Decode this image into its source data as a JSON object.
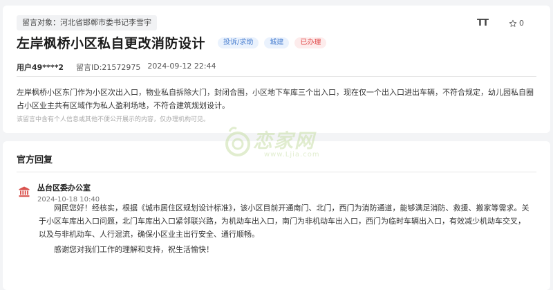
{
  "message": {
    "target": "留言对象：河北省邯郸市委书记李雪宇",
    "title": "左岸枫桥小区私自更改消防设计",
    "tags": [
      {
        "label": "投诉/求助",
        "style": "blue"
      },
      {
        "label": "城建",
        "style": "blue"
      },
      {
        "label": "已办理",
        "style": "red"
      }
    ],
    "font_toggle": "TT",
    "favorites_count": "0",
    "user": "用户49****2",
    "message_id": "留言ID:21572975",
    "datetime": "2024-09-12 22:44",
    "content": "左岸枫桥小区东门作为小区次出入口，物业私自拆除大门，封闭合围，小区地下车库三个出入口，现在仅一个出入口进出车辆，不符合规定，幼儿园私自圈占小区业主共有区域作为私人盈利场地，不符合建筑规划设计。",
    "notice": "该留言中含有个人信息或其他不便公开展示的内容，仅办理机构可见。"
  },
  "reply": {
    "section_title": "官方回复",
    "org_name": "丛台区委办公室",
    "datetime": "2024-10-18 10:40",
    "paragraph1": "网民您好！经核实，根据《城市居住区规划设计标准》，该小区目前开通南门、北门，西门为消防通道，能够满足消防、救援、搬家等需求。关于小区车库出入口问题，北门车库出入口紧邻联兴路，为机动车出入口，南门为非机动车出入口，西门为临时车辆出入口，有效减少机动车交叉，以及与非机动车、人行混流，确保小区业主出行安全、通行顺畅。",
    "paragraph2": "感谢您对我们工作的理解和支持，祝生活愉快！"
  },
  "watermark": {
    "text": "恋家网",
    "sub": "www.Ljia.com"
  },
  "colors": {
    "accent_blue": "#4a7fd0",
    "status_red": "#e04848",
    "org_icon": "#d9534f",
    "watermark": "#c9dfa8"
  }
}
